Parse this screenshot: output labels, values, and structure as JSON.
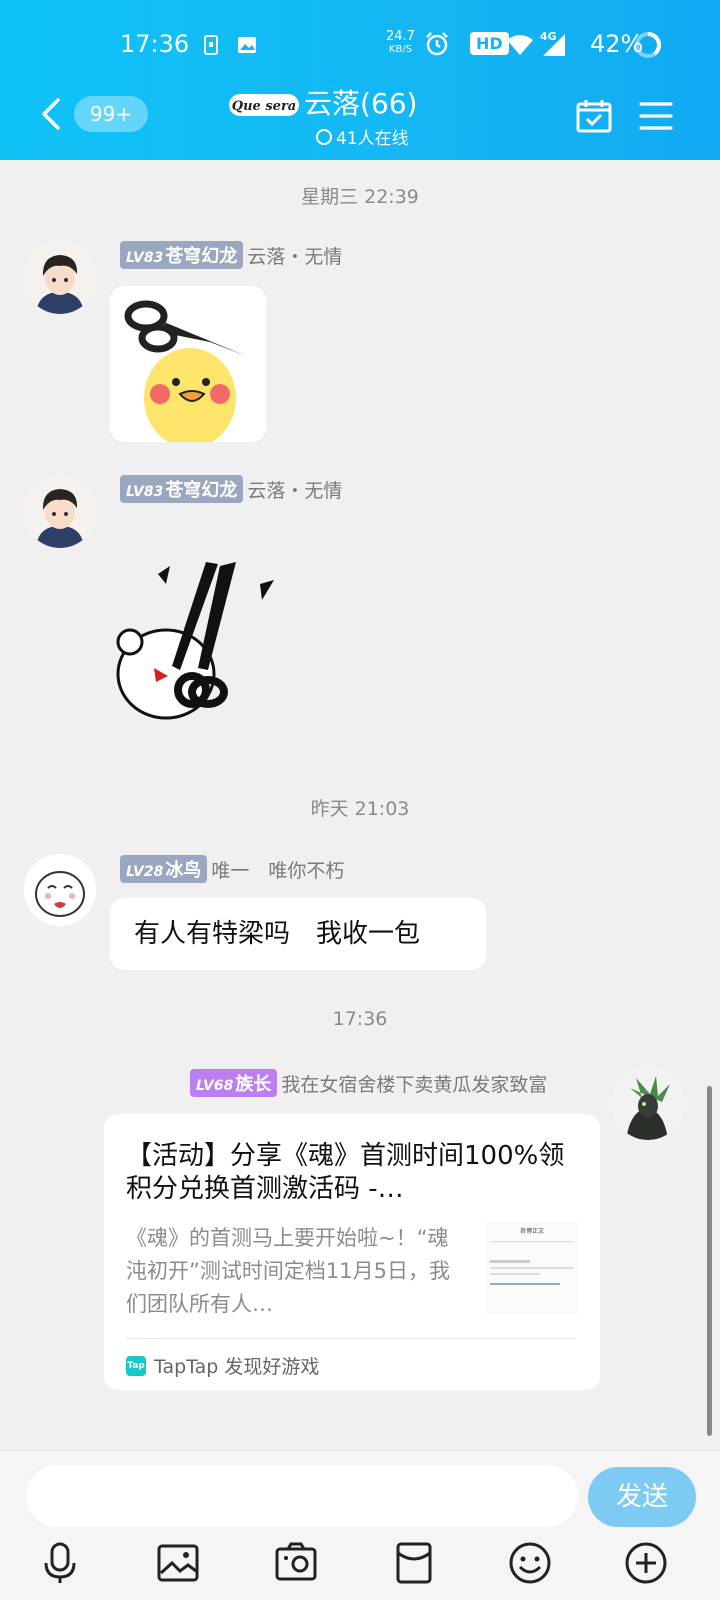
{
  "status_bar": {
    "time": "17:36",
    "net_speed_value": "24.7",
    "net_speed_unit": "KB/S",
    "hd_label": "HD",
    "network_label": "4G",
    "battery": "42%"
  },
  "header": {
    "unread_badge": "99+",
    "group_name": "云落(66)",
    "online_count": "41人在线",
    "logo_text": "Que sera"
  },
  "messages": [
    {
      "timestamp": "星期三 22:39"
    },
    {
      "level": "LV83",
      "title": "苍穹幻龙",
      "nickname": "云落・无情",
      "type": "sticker",
      "sticker": "duck-with-scissors"
    },
    {
      "level": "LV83",
      "title": "苍穹幻龙",
      "nickname": "云落・无情",
      "type": "sticker",
      "sticker": "bear-with-scissors"
    },
    {
      "timestamp": "昨天 21:03"
    },
    {
      "level": "LV28",
      "title": "冰鸟",
      "nickname": "唯一　唯你不朽",
      "type": "text",
      "text": "有人有特梁吗　我收一包"
    },
    {
      "timestamp": "17:36"
    },
    {
      "level": "LV68",
      "title": "族长",
      "nickname": "我在女宿舍楼下卖黄瓜发家致富",
      "type": "card",
      "card": {
        "title": "【活动】分享《魂》首测时间100%领积分兑换首测激活码 -…",
        "description": "《魂》的首测马上要开始啦~！“魂沌初开”测试时间定档11月5日，我们团队所有人…",
        "thumbnail_title": "奇博正文",
        "source": "TapTap 发现好游戏",
        "source_logo": "Tap"
      }
    }
  ],
  "composer": {
    "input_value": "",
    "send_label": "发送"
  },
  "toolbar_icons": [
    "microphone-icon",
    "image-icon",
    "camera-icon",
    "red-packet-icon",
    "emoji-icon",
    "plus-icon"
  ],
  "colors": {
    "header": "#14b6f3",
    "send": "#7dcaf3",
    "level_tag": "#9aa7bf",
    "chief_tag": "#bc7ff0"
  }
}
